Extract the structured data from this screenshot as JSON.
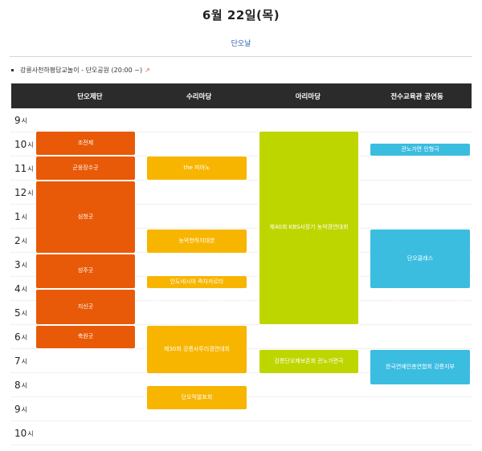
{
  "page": {
    "title": "6월 22일(목)",
    "sub_label": "단오날"
  },
  "event": {
    "text": "강릉사천하평답교놀이 - 단오공원 (20:00 ~)",
    "link_icon": "external-link-icon"
  },
  "columns": [
    "단오제단",
    "수리마당",
    "아리마당",
    "전수교육관 공연동"
  ],
  "time_rows": [
    "9",
    "10",
    "11",
    "12",
    "1",
    "2",
    "3",
    "4",
    "5",
    "6",
    "7",
    "8",
    "9",
    "10"
  ],
  "time_unit": "시",
  "colors": {
    "orange": "#e85a07",
    "yellow": "#f7b500",
    "lime": "#bed600",
    "blue": "#3bbde0",
    "header_bg": "#2b2b2b"
  },
  "events": [
    {
      "label": "조전제",
      "color": "orange"
    },
    {
      "label": "군웅장수굿",
      "color": "orange"
    },
    {
      "label": "심청굿",
      "color": "orange"
    },
    {
      "label": "성주굿",
      "color": "orange"
    },
    {
      "label": "지신굿",
      "color": "orange"
    },
    {
      "label": "축원굿",
      "color": "orange"
    },
    {
      "label": "the 피아노",
      "color": "yellow"
    },
    {
      "label": "농악천하지대본",
      "color": "yellow"
    },
    {
      "label": "인도네시아 족자카르타",
      "color": "yellow"
    },
    {
      "label": "제30회 강릉사투리경연대회",
      "color": "yellow"
    },
    {
      "label": "단오먹발표회",
      "color": "yellow"
    },
    {
      "label": "제40회 KBS사장기 농악경연대회",
      "color": "lime"
    },
    {
      "label": "강릉단오제보존회 관노가면극",
      "color": "lime"
    },
    {
      "label": "관노가면 인형극",
      "color": "blue"
    },
    {
      "label": "단오클래스",
      "color": "blue"
    },
    {
      "label": "한국연예인총연합회 강릉지부",
      "color": "blue"
    }
  ]
}
